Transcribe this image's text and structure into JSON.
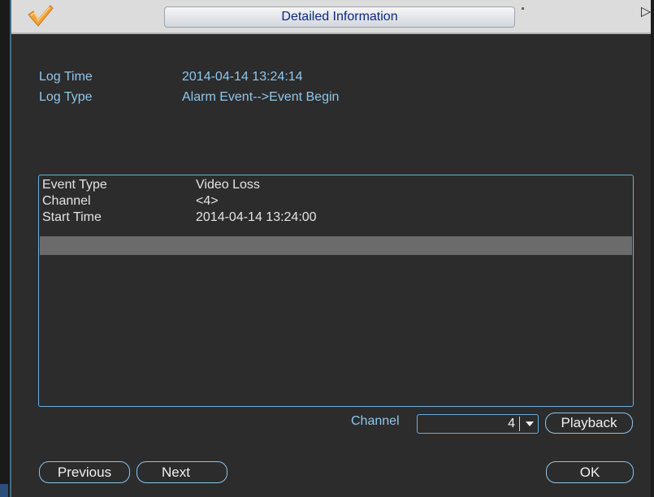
{
  "window": {
    "title": "Detailed Information",
    "logo_icon": "checkmark-logo-icon",
    "close_icon": "close-icon"
  },
  "info": {
    "log_time_label": "Log Time",
    "log_time_value": "2014-04-14 13:24:14",
    "log_type_label": "Log Type",
    "log_type_value": "Alarm Event-->Event Begin"
  },
  "details": {
    "rows": [
      {
        "label": "Event Type",
        "value": "Video Loss"
      },
      {
        "label": "Channel",
        "value": "<4>"
      },
      {
        "label": "Start Time",
        "value": "2014-04-14 13:24:00"
      }
    ]
  },
  "footer": {
    "channel_label": "Channel",
    "channel_value": "4",
    "playback_label": "Playback",
    "previous_label": "Previous",
    "next_label": "Next",
    "ok_label": "OK"
  },
  "colors": {
    "info_text": "#8fc7ee",
    "detail_text": "#e4e4e4",
    "border_accent": "#6aaee0",
    "title_text": "#0d2a7c",
    "background": "#2c2c2c",
    "selected_row": "#6b6b6b"
  }
}
